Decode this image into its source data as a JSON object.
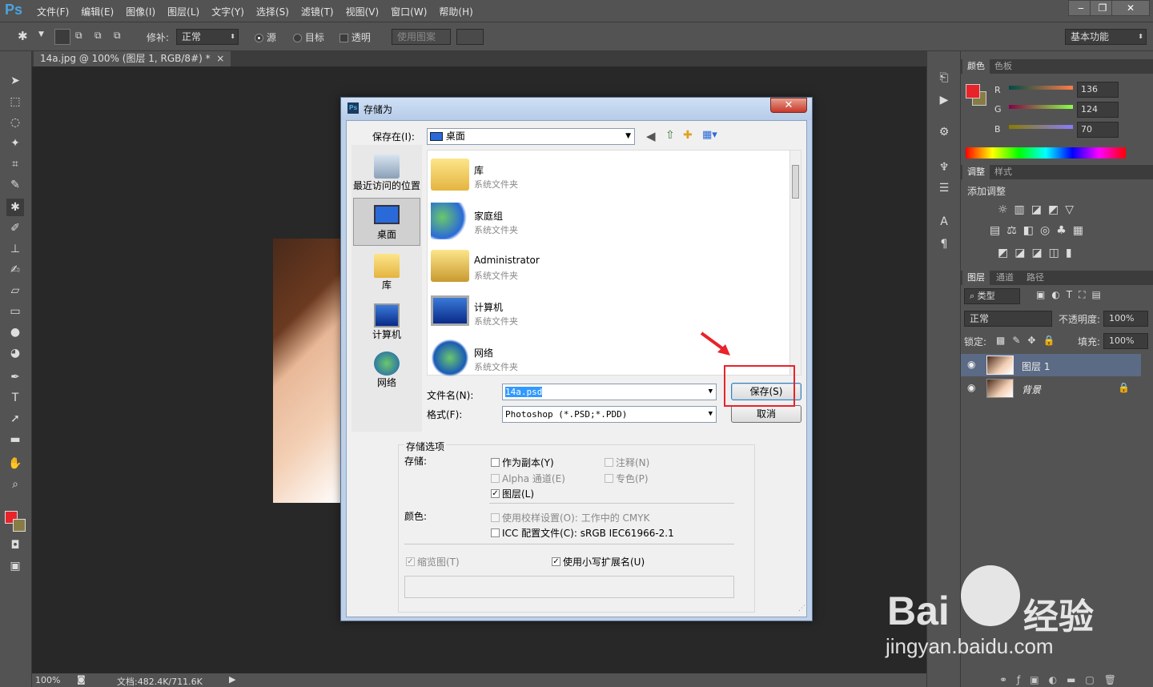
{
  "app": {
    "logo": "Ps"
  },
  "menu": [
    "文件(F)",
    "编辑(E)",
    "图像(I)",
    "图层(L)",
    "文字(Y)",
    "选择(S)",
    "滤镜(T)",
    "视图(V)",
    "窗口(W)",
    "帮助(H)"
  ],
  "window_controls": {
    "minimize": "‒",
    "restore": "❐",
    "close": "✕"
  },
  "options_bar": {
    "patch_label": "修补:",
    "patch_mode": "正常",
    "source_label": "源",
    "target_label": "目标",
    "transparent_label": "透明",
    "use_pattern_label": "使用图案",
    "workspace": "基本功能"
  },
  "document": {
    "tab_title": "14a.jpg @ 100% (图层 1, RGB/8#) *",
    "tab_close": "×"
  },
  "status": {
    "zoom": "100%",
    "doc_size": "文档:482.4K/711.6K"
  },
  "color_panel": {
    "tabs": [
      "颜色",
      "色板"
    ],
    "r_label": "R",
    "g_label": "G",
    "b_label": "B",
    "r": "136",
    "g": "124",
    "b": "70",
    "fg_color": "#e8232a",
    "bg_color": "#887c46"
  },
  "adjust_panel": {
    "tabs": [
      "调整",
      "样式"
    ],
    "heading": "添加调整"
  },
  "layers_panel": {
    "tabs": [
      "图层",
      "通道",
      "路径"
    ],
    "filter": "类型",
    "blend_mode": "正常",
    "opacity_label": "不透明度:",
    "opacity": "100%",
    "lock_label": "锁定:",
    "fill_label": "填充:",
    "fill": "100%",
    "layers": [
      {
        "name": "图层 1"
      },
      {
        "name": "背景"
      }
    ]
  },
  "dialog": {
    "title": "存储为",
    "close": "✕",
    "save_in_label": "保存在(I):",
    "save_in_value": "桌面",
    "places": [
      "最近访问的位置",
      "桌面",
      "库",
      "计算机",
      "网络"
    ],
    "files": [
      {
        "name": "库",
        "type": "系统文件夹"
      },
      {
        "name": "家庭组",
        "type": "系统文件夹"
      },
      {
        "name": "Administrator",
        "type": "系统文件夹"
      },
      {
        "name": "计算机",
        "type": "系统文件夹"
      },
      {
        "name": "网络",
        "type": "系统文件夹"
      }
    ],
    "filename_label": "文件名(N):",
    "filename": "14a.psd",
    "format_label": "格式(F):",
    "format": "Photoshop (*.PSD;*.PDD)",
    "save_button": "保存(S)",
    "cancel_button": "取消",
    "options_title": "存储选项",
    "save_label": "存储:",
    "as_copy": "作为副本(Y)",
    "notes": "注释(N)",
    "alpha": "Alpha 通道(E)",
    "spot": "专色(P)",
    "layers": "图层(L)",
    "color_label": "颜色:",
    "use_proof": "使用校样设置(O):",
    "proof_value": "工作中的 CMYK",
    "icc": "ICC 配置文件(C):",
    "icc_value": "sRGB IEC61966-2.1",
    "thumbnail": "缩览图(T)",
    "lowercase_ext": "使用小写扩展名(U)"
  },
  "watermark": {
    "brand": "Bai",
    "brand_cn": "经验",
    "url": "jingyan.baidu.com"
  }
}
